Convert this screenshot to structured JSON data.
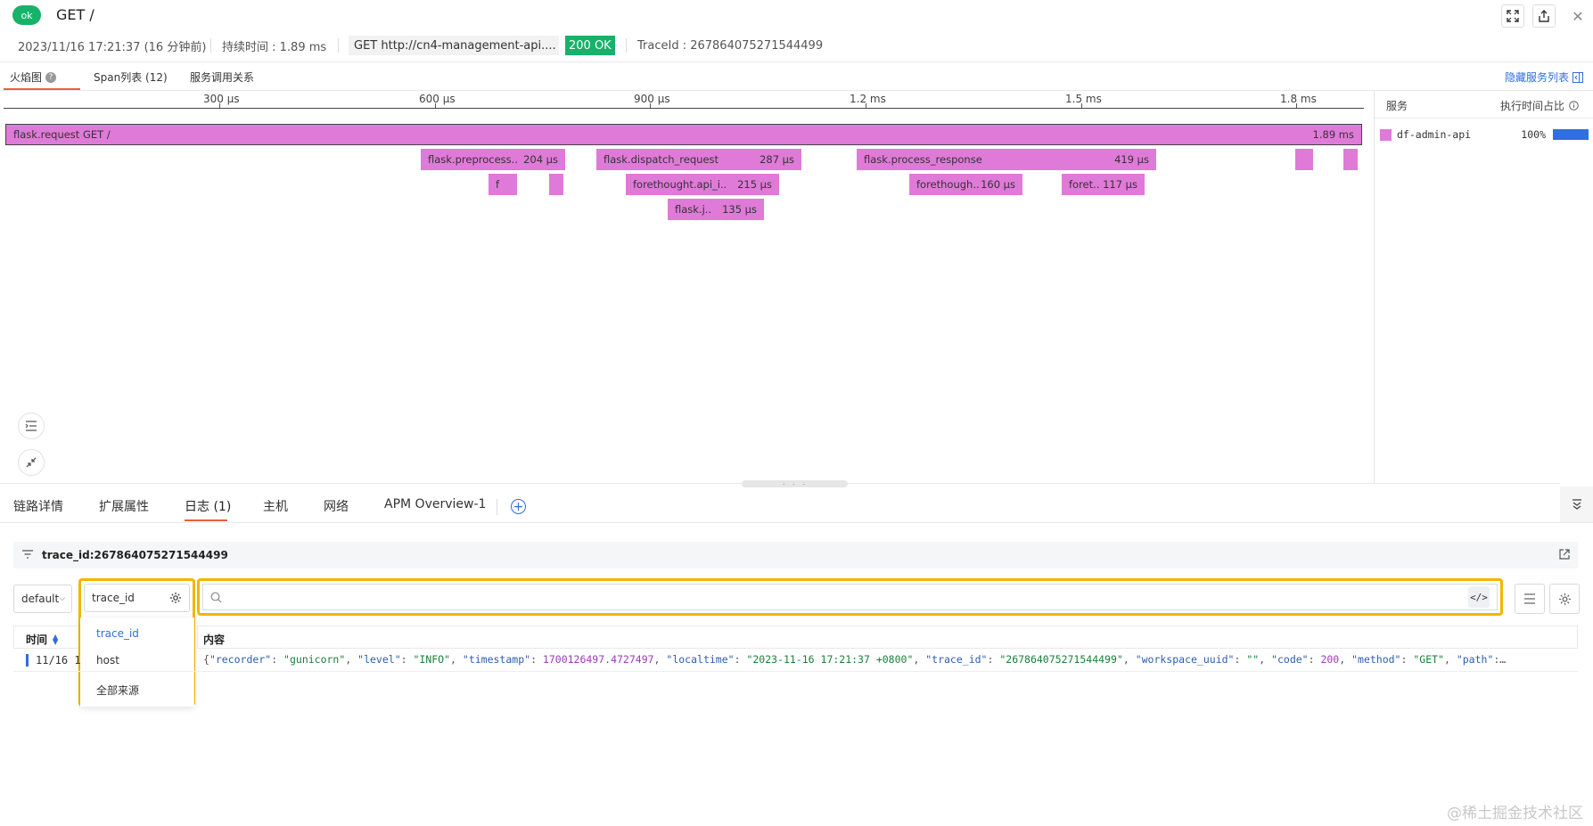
{
  "header": {
    "status": "ok",
    "title": "GET /",
    "datetime": "2023/11/16 17:21:37 (16 分钟前)",
    "duration": "持续时间 : 1.89 ms",
    "method_url": "GET  http://cn4-management-api....",
    "http_status": "200 OK",
    "trace_id": "TraceId : 267864075271544499",
    "icons": [
      "fullscreen-icon",
      "share-icon",
      "close-icon"
    ]
  },
  "view_tabs": {
    "flame": "火焰图",
    "spans": "Span列表 (12)",
    "service_map": "服务调用关系",
    "hide_services": "隐藏服务列表"
  },
  "axis": {
    "ticks": [
      "300 μs",
      "600 μs",
      "900 μs",
      "1.2 ms",
      "1.5 ms",
      "1.8 ms"
    ]
  },
  "spans": [
    {
      "name": "flask.request GET /",
      "duration": "1.89 ms"
    },
    {
      "name": "flask.preprocess..",
      "duration": "204 μs"
    },
    {
      "name": "flask.dispatch_request",
      "duration": "287 μs"
    },
    {
      "name": "flask.process_response",
      "duration": "419 μs"
    },
    {
      "name": "f",
      "duration": ""
    },
    {
      "name": "forethought.api_i..",
      "duration": "215 μs"
    },
    {
      "name": "forethough..",
      "duration": "160 μs"
    },
    {
      "name": "foret..",
      "duration": "117 μs"
    },
    {
      "name": "flask.j..",
      "duration": "135 μs"
    }
  ],
  "services_panel": {
    "col_service": "服务",
    "col_ratio": "执行时间占比",
    "rows": [
      {
        "name": "df-admin-api",
        "pct": "100%",
        "color": "#e07ad8"
      }
    ]
  },
  "bottom_tabs": [
    "链路详情",
    "扩展属性",
    "日志 (1)",
    "主机",
    "网络",
    "APM Overview-1"
  ],
  "log_panel": {
    "filter": "trace_id:267864075271544499",
    "index_select": "default",
    "field_select": "trace_id",
    "search_placeholder": "",
    "dropdown_options": [
      "trace_id",
      "host",
      "全部来源"
    ],
    "col_time": "时间",
    "col_content": "内容",
    "row_time": "11/16 1"
  },
  "watermark": "@稀土掘金技术社区",
  "colors": {
    "accent": "#2f6fde",
    "ok": "#17b26a",
    "span": "#e07ad8",
    "highlight": "#f2b600",
    "tab_active": "#e8603c"
  }
}
